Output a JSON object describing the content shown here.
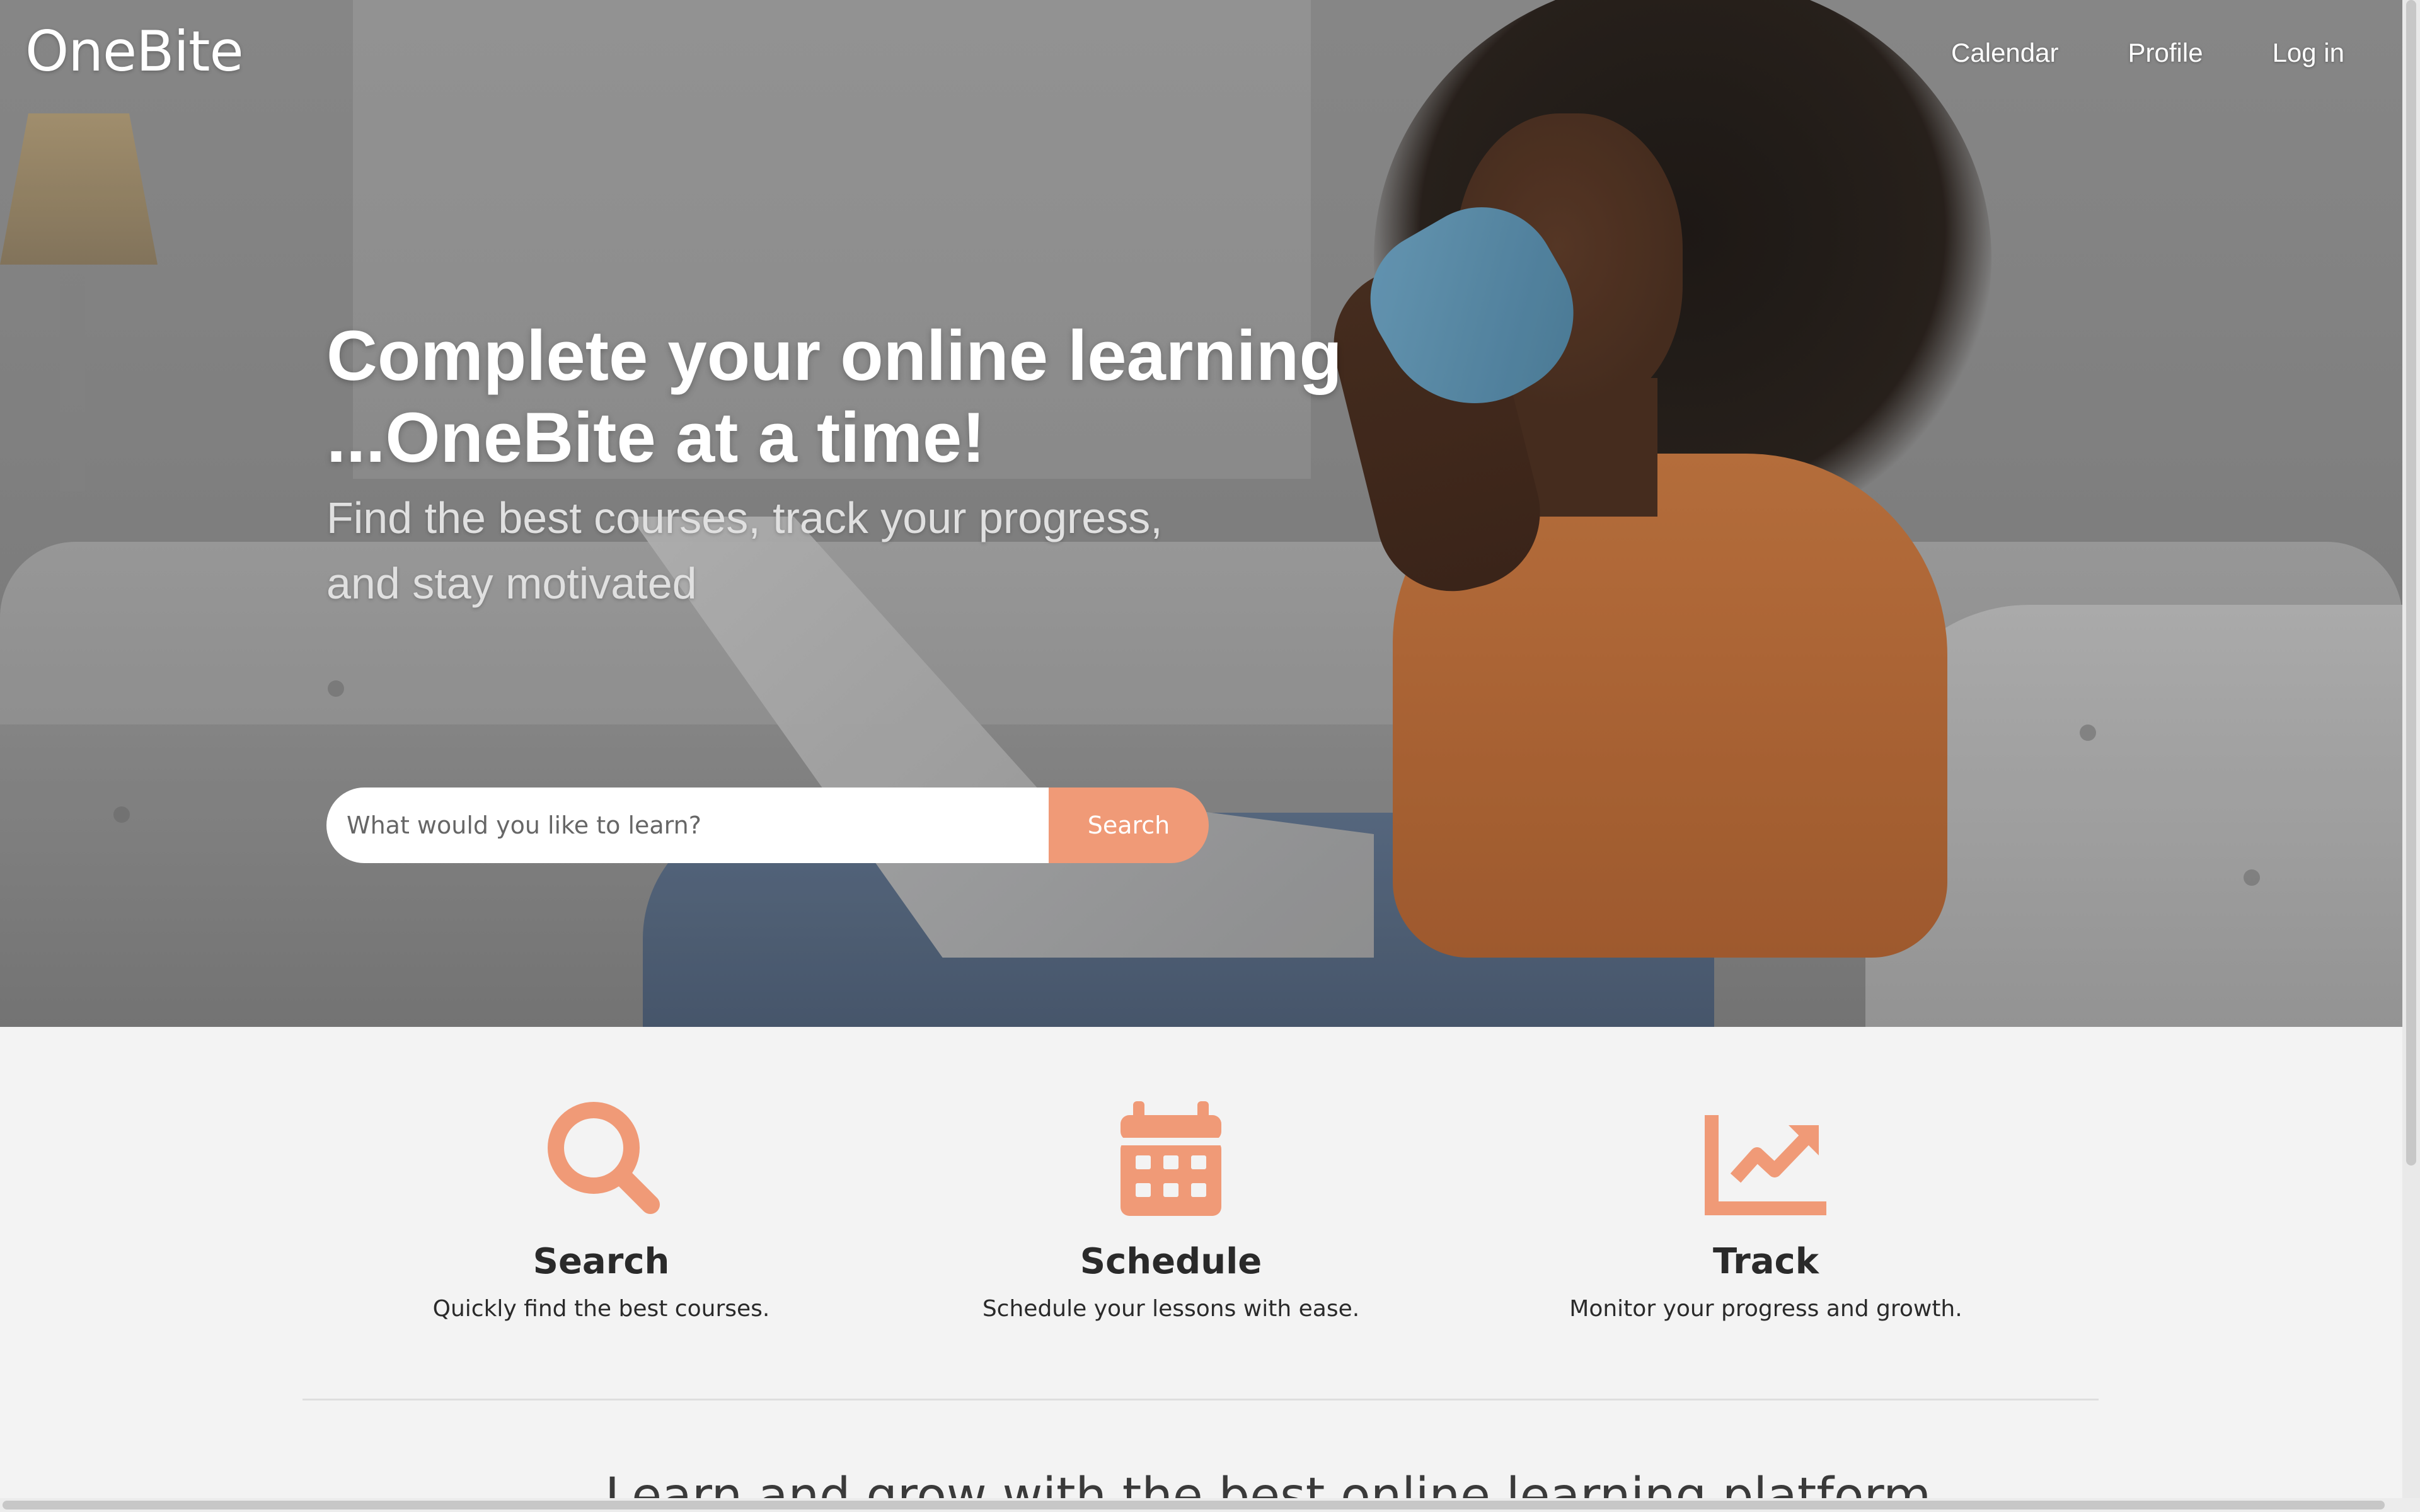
{
  "brand": {
    "logo_text": "OneBite",
    "accent_color": "#f09a77"
  },
  "nav": {
    "items": [
      {
        "label": "Calendar"
      },
      {
        "label": "Profile"
      },
      {
        "label": "Log in"
      }
    ]
  },
  "hero": {
    "headline_line1": "Complete your online learning",
    "headline_line2": "...OneBite at a time!",
    "subhead_line1": "Find the best courses, track your progress,",
    "subhead_line2": "and stay motivated",
    "search": {
      "placeholder": "What would you like to learn?",
      "value": "",
      "button_label": "Search"
    }
  },
  "features": [
    {
      "icon": "search-icon",
      "title": "Search",
      "description": "Quickly find the best courses."
    },
    {
      "icon": "calendar-icon",
      "title": "Schedule",
      "description": "Schedule your lessons with ease."
    },
    {
      "icon": "chart-line-icon",
      "title": "Track",
      "description": "Monitor your progress and growth."
    }
  ],
  "next_section": {
    "heading_partial": "Learn and grow with the best online learning platform"
  }
}
